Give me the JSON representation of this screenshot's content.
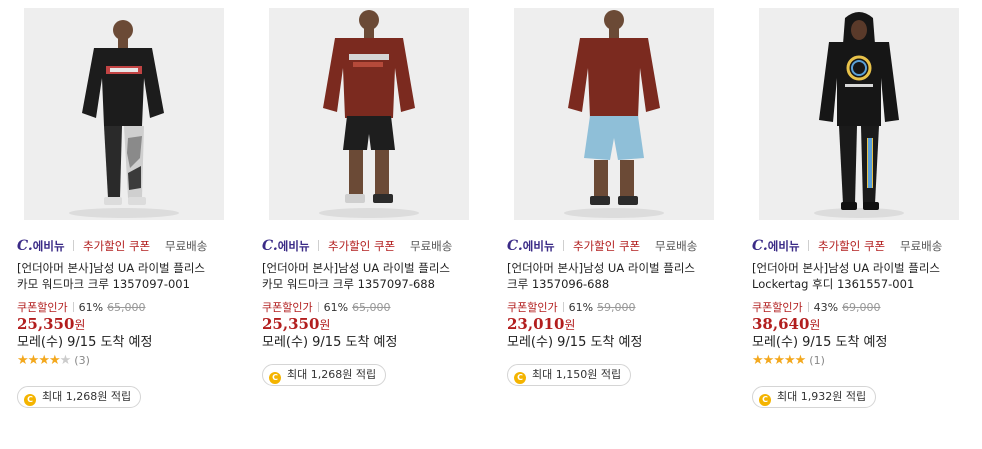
{
  "products": [
    {
      "brand_c": "C.",
      "brand_name": "에비뉴",
      "extra_discount": "추가할인 쿠폰",
      "shipping": "무료배송",
      "title_line1": "[언더아머 본사]남성 UA 라이벌 플리스",
      "title_line2": "카모 워드마크 크루 1357097-001",
      "coupon_label": "쿠폰할인가",
      "discount": "61%",
      "original_price": "65,000",
      "price": "25,350",
      "won": "원",
      "delivery": "모레(수) 9/15 도착 예정",
      "rating": 4,
      "review_count": "(3)",
      "reward_icon": "C",
      "reward": "최대 1,268원 적립",
      "image_colors": {
        "top": "#1c1c1c",
        "bottom": "#2a2a2a"
      }
    },
    {
      "brand_c": "C.",
      "brand_name": "에비뉴",
      "extra_discount": "추가할인 쿠폰",
      "shipping": "무료배송",
      "title_line1": "[언더아머 본사]남성 UA 라이벌 플리스",
      "title_line2": "카모 워드마크 크루 1357097-688",
      "coupon_label": "쿠폰할인가",
      "discount": "61%",
      "original_price": "65,000",
      "price": "25,350",
      "won": "원",
      "delivery": "모레(수) 9/15 도착 예정",
      "reward_icon": "C",
      "reward": "최대 1,268원 적립",
      "image_colors": {
        "top": "#7b2a1f",
        "bottom": "#1e1e1e"
      }
    },
    {
      "brand_c": "C.",
      "brand_name": "에비뉴",
      "extra_discount": "추가할인 쿠폰",
      "shipping": "무료배송",
      "title_line1": "[언더아머 본사]남성 UA 라이벌 플리스",
      "title_line2": "크루 1357096-688",
      "coupon_label": "쿠폰할인가",
      "discount": "61%",
      "original_price": "59,000",
      "price": "23,010",
      "won": "원",
      "delivery": "모레(수) 9/15 도착 예정",
      "reward_icon": "C",
      "reward": "최대 1,150원 적립",
      "image_colors": {
        "top": "#7b2a1f",
        "bottom": "#8fbfd8"
      }
    },
    {
      "brand_c": "C.",
      "brand_name": "에비뉴",
      "extra_discount": "추가할인 쿠폰",
      "shipping": "무료배송",
      "title_line1": "[언더아머 본사]남성 UA 라이벌 플리스",
      "title_line2": "Lockertag 후디 1361557-001",
      "coupon_label": "쿠폰할인가",
      "discount": "43%",
      "original_price": "69,000",
      "price": "38,640",
      "won": "원",
      "delivery": "모레(수) 9/15 도착 예정",
      "rating": 5,
      "review_count": "(1)",
      "reward_icon": "C",
      "reward": "최대 1,932원 적립",
      "image_colors": {
        "top": "#161616",
        "bottom": "#161616"
      }
    }
  ],
  "colors": {
    "brand": "#3a2a86",
    "accent_red": "#b21e1e",
    "star": "#f3a81e",
    "coin": "#f4b400"
  }
}
